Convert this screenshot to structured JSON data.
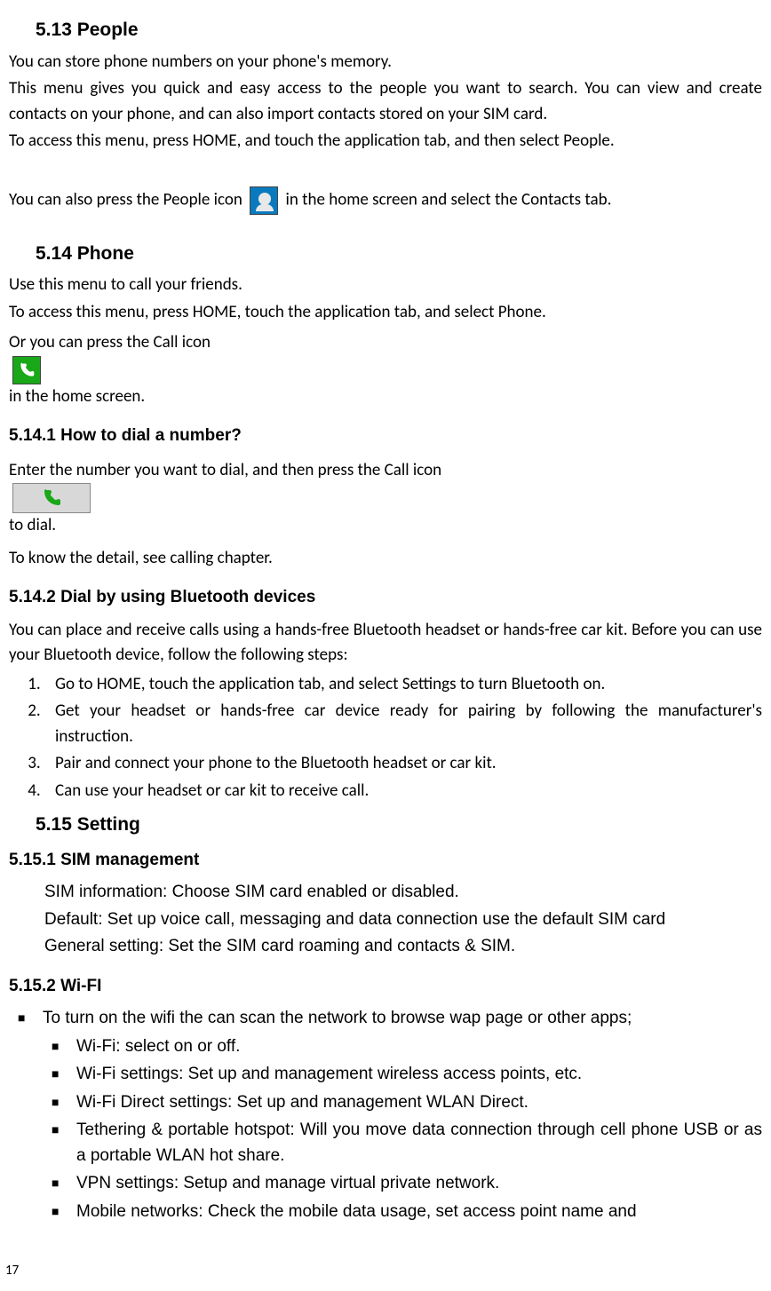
{
  "page_number": "17",
  "sections": {
    "people": {
      "heading": "5.13  People",
      "p1": "You can store phone numbers on your phone's memory.",
      "p2": "This menu gives you quick and easy access to the people you want to search. You can view and create contacts on your phone, and can also import contacts stored on your SIM card.",
      "p3": "To access this menu, press HOME, and touch the application tab, and then select People.",
      "p4_pre": "You can also press the People icon  ",
      "p4_post": "  in the home screen and select the Contacts tab."
    },
    "phone": {
      "heading": "5.14  Phone",
      "p1": "Use this menu to call your friends.",
      "p2": "To access this menu, press HOME, touch the application tab, and select Phone.",
      "p3_pre": "Or you can press the Call icon  ",
      "p3_post": "  in the home screen.",
      "sub1": {
        "heading": "5.14.1  How to dial a number?",
        "p1_pre": "Enter the number you want to dial, and then press the Call icon  ",
        "p1_post": "  to dial.",
        "p2": "To know the detail, see calling chapter."
      },
      "sub2": {
        "heading": "5.14.2  Dial by using Bluetooth devices",
        "p1": "You can place and receive calls using a hands-free Bluetooth headset or hands-free car kit. Before you can use your Bluetooth device, follow the following steps:",
        "li1": "Go to HOME, touch the application tab, and select Settings to turn Bluetooth on.",
        "li2": "Get your headset or hands-free car device ready for pairing by following the manufacturer's instruction.",
        "li3": "Pair and connect your phone to the Bluetooth headset or car kit.",
        "li4": "Can use your headset or car kit to receive call."
      }
    },
    "setting": {
      "heading": "5.15  Setting",
      "sim": {
        "heading": "5.15.1  SIM management",
        "p1": "SIM information: Choose SIM card enabled or disabled.",
        "p2": "Default: Set up voice call, messaging and data connection use the default SIM card",
        "p3": "General setting: Set the SIM card roaming and contacts & SIM."
      },
      "wifi": {
        "heading": "5.15.2  Wi-FI",
        "outer": "To turn on the wifi the can scan the network to browse wap page or other apps;",
        "li1": "Wi-Fi: select on or off.",
        "li2": "Wi-Fi settings: Set up and management wireless access points, etc.",
        "li3": "Wi-Fi Direct settings: Set up and management WLAN Direct.",
        "li4": "Tethering & portable hotspot: Will you move data connection through cell phone USB or as a portable WLAN hot share.",
        "li5": "VPN settings: Setup and manage virtual private network.",
        "li6": "Mobile networks: Check the mobile data usage, set access point name and"
      }
    }
  }
}
